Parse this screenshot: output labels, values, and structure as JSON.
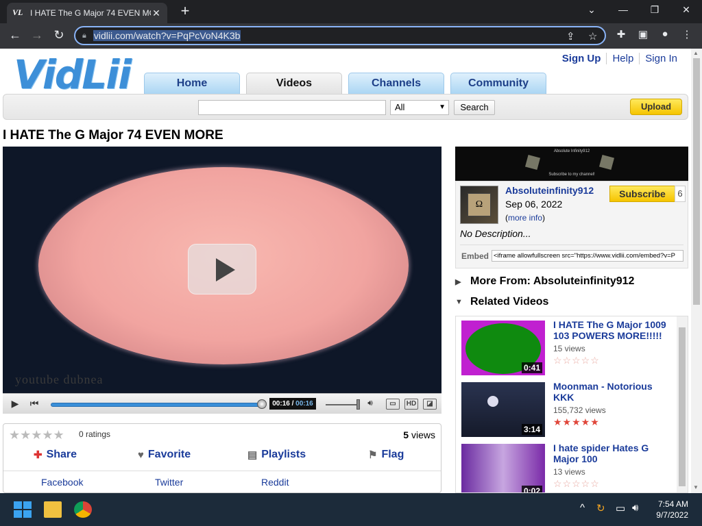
{
  "browser": {
    "tab_title": "I HATE The G Major 74 EVEN MO",
    "favicon_text": "VL",
    "url": "vidlii.com/watch?v=PqPcVoN4K3b"
  },
  "site": {
    "logo": "VidLii",
    "top_links": [
      "Sign Up",
      "Help",
      "Sign In"
    ],
    "nav_tabs": [
      "Home",
      "Videos",
      "Channels",
      "Community"
    ],
    "active_tab": "Videos",
    "search": {
      "value": "",
      "select": "All",
      "button": "Search"
    },
    "upload": "Upload"
  },
  "video": {
    "title": "I HATE The G Major 74 EVEN MORE",
    "watermark": "youtube  dubnea",
    "time_current": "00:16",
    "time_total": "00:16",
    "progress": 1.0,
    "ratings_label": "0 ratings",
    "views_count": "5",
    "views_label": "views",
    "actions": [
      "Share",
      "Favorite",
      "Playlists",
      "Flag"
    ],
    "share_links": [
      "Facebook",
      "Twitter",
      "Reddit"
    ]
  },
  "channel": {
    "banner_top": "Absolute Infinity912",
    "banner_bottom": "Subscribe to my channel!",
    "name": "Absoluteinfinity912",
    "date": "Sep 06, 2022",
    "more_info": "more info",
    "subscribe": "Subscribe",
    "subscriber_count": "6",
    "description": "No Description...",
    "embed_label": "Embed",
    "embed_code": "<iframe allowfullscreen src=\"https://www.vidlii.com/embed?v=P"
  },
  "sections": {
    "more_from": "More From: Absoluteinfinity912",
    "related": "Related Videos"
  },
  "related_videos": [
    {
      "title": "I HATE The G Major 1009 103 POWERS MORE!!!!!",
      "views": "15 views",
      "duration": "0:41",
      "rating": 0
    },
    {
      "title": "Moonman - Notorious KKK",
      "views": "155,732 views",
      "duration": "3:14",
      "rating": 5
    },
    {
      "title": "I hate spider Hates G Major 100",
      "views": "13 views",
      "duration": "0:02",
      "rating": 0
    }
  ],
  "taskbar": {
    "time": "7:54 AM",
    "date": "9/7/2022"
  },
  "colors": {
    "link": "#1a3b9a",
    "subscribe": "#f5c400",
    "star_filled": "#e0463a",
    "star_empty": "#e8a8a0"
  }
}
